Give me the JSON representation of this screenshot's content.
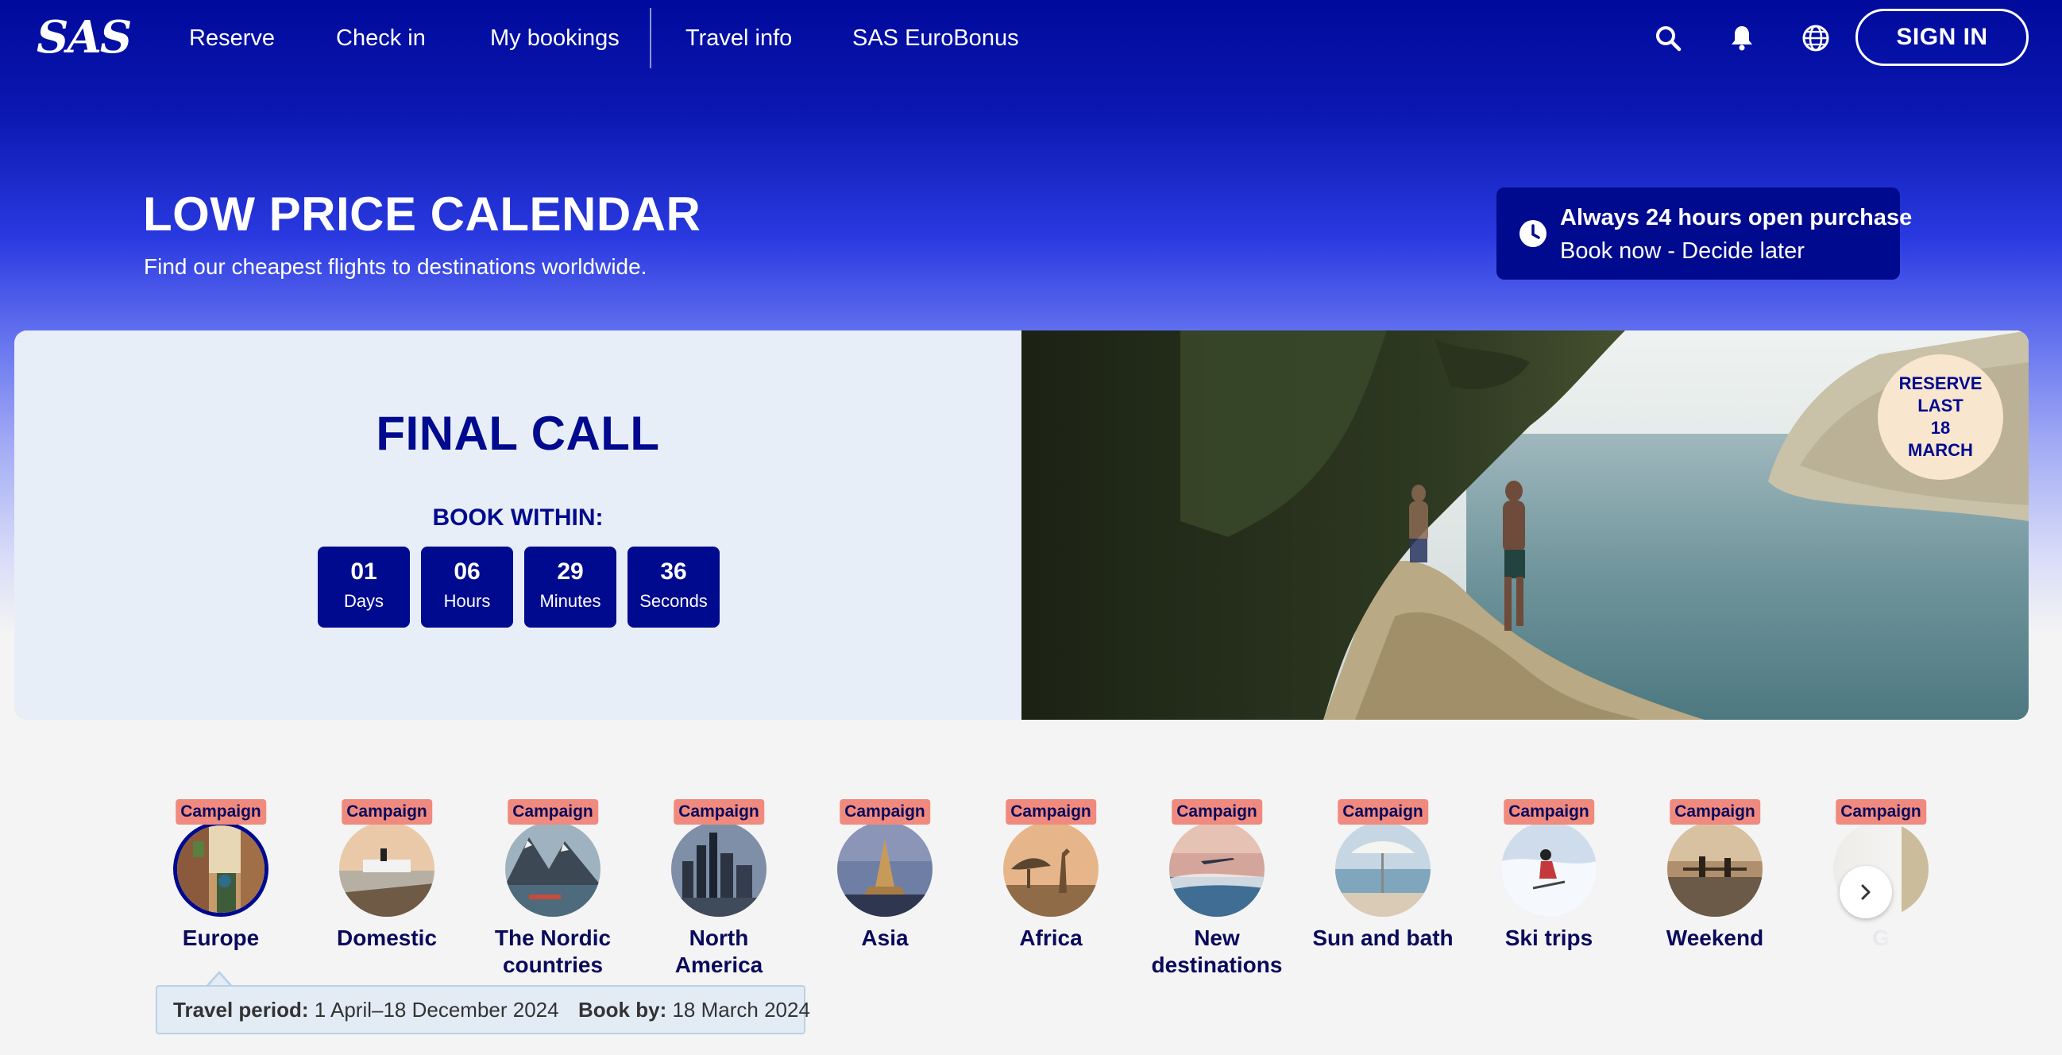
{
  "brand": {
    "logo_text": "SAS"
  },
  "nav": {
    "items": [
      {
        "label": "Reserve"
      },
      {
        "label": "Check in"
      },
      {
        "label": "My bookings"
      },
      {
        "label": "Travel info"
      },
      {
        "label": "SAS EuroBonus"
      }
    ],
    "icons": [
      "search-icon",
      "bell-icon",
      "globe-icon"
    ],
    "sign_in": "SIGN IN"
  },
  "hero": {
    "title": "LOW PRICE CALENDAR",
    "subtitle": "Find our cheapest flights to destinations worldwide.",
    "promo": {
      "line1": "Always 24 hours open purchase",
      "line2": "Book now - Decide later"
    }
  },
  "banner": {
    "heading": "FINAL CALL",
    "book_within": "BOOK WITHIN:",
    "countdown": [
      {
        "value": "01",
        "unit": "Days"
      },
      {
        "value": "06",
        "unit": "Hours"
      },
      {
        "value": "29",
        "unit": "Minutes"
      },
      {
        "value": "36",
        "unit": "Seconds"
      }
    ],
    "badge": [
      "RESERVE",
      "LAST",
      "18",
      "MARCH"
    ]
  },
  "categories": [
    {
      "tag": "Campaign",
      "label": "Europe",
      "selected": true
    },
    {
      "tag": "Campaign",
      "label": "Domestic"
    },
    {
      "tag": "Campaign",
      "label": "The Nordic countries"
    },
    {
      "tag": "Campaign",
      "label": "North America"
    },
    {
      "tag": "Campaign",
      "label": "Asia"
    },
    {
      "tag": "Campaign",
      "label": "Africa"
    },
    {
      "tag": "Campaign",
      "label": "New destinations"
    },
    {
      "tag": "Campaign",
      "label": "Sun and bath"
    },
    {
      "tag": "Campaign",
      "label": "Ski trips"
    },
    {
      "tag": "Campaign",
      "label": "Weekend"
    },
    {
      "tag": "Campaign",
      "label": "G"
    }
  ],
  "info": {
    "travel_period_label": "Travel period:",
    "travel_period_value": "1 April–18 December 2024",
    "book_by_label": "Book by:",
    "book_by_value": "18 March 2024"
  },
  "colors": {
    "brand_blue": "#000a8e",
    "campaign_tag": "#f08a7e",
    "badge": "#f8e6cf"
  }
}
